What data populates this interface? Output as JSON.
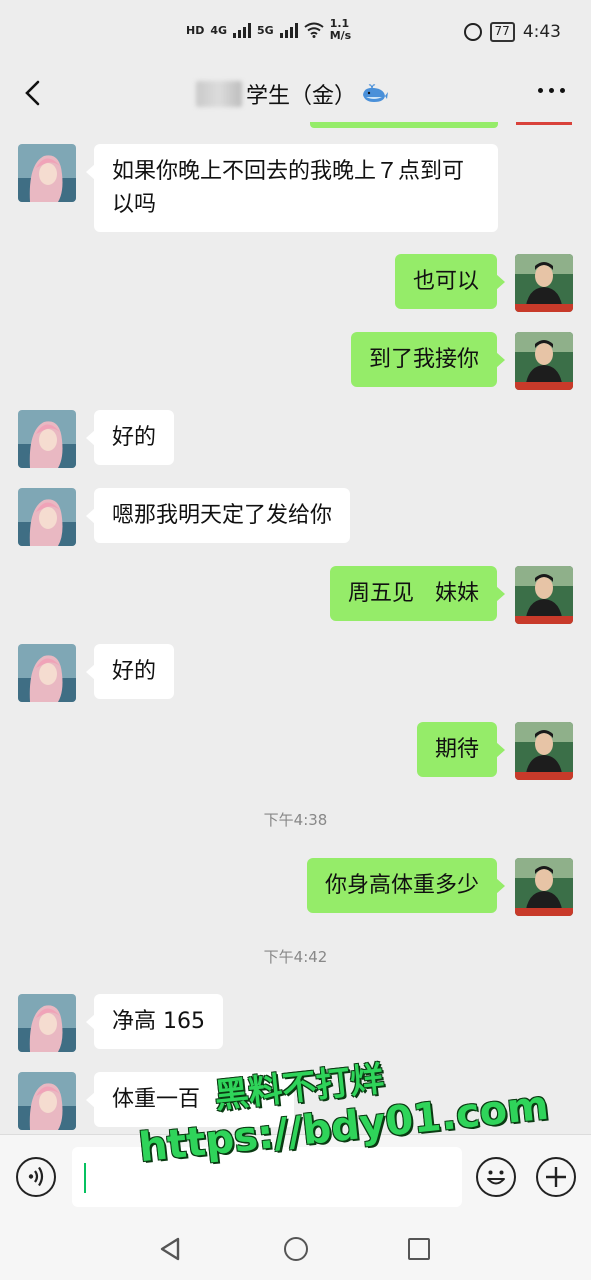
{
  "status_bar": {
    "network_left_1": "HD",
    "network_4g": "4G",
    "network_5g": "5G",
    "speed_value": "1.1",
    "speed_unit": "M/s",
    "battery": "77",
    "time": "4:43"
  },
  "nav": {
    "title": "学生（金）"
  },
  "messages": [
    {
      "side": "left",
      "text": "如果你晚上不回去的我晚上７点到可以吗"
    },
    {
      "side": "right",
      "text": "也可以"
    },
    {
      "side": "right",
      "text": "到了我接你"
    },
    {
      "side": "left",
      "text": "好的"
    },
    {
      "side": "left",
      "text": "嗯那我明天定了发给你"
    },
    {
      "side": "right",
      "text": "周五见   妹妹"
    },
    {
      "side": "left",
      "text": "好的"
    },
    {
      "side": "right",
      "text": "期待"
    },
    {
      "side": "time",
      "text": "下午4:38"
    },
    {
      "side": "right",
      "text": "你身高体重多少"
    },
    {
      "side": "time",
      "text": "下午4:42"
    },
    {
      "side": "left",
      "text": "净高 165"
    },
    {
      "side": "left",
      "text": "体重一百"
    }
  ],
  "watermark": {
    "line1": "黑料不打烊",
    "line2": "https://bdy01.com"
  },
  "colors": {
    "sent_bubble": "#95ec69",
    "received_bubble": "#ffffff",
    "background": "#ededed"
  }
}
